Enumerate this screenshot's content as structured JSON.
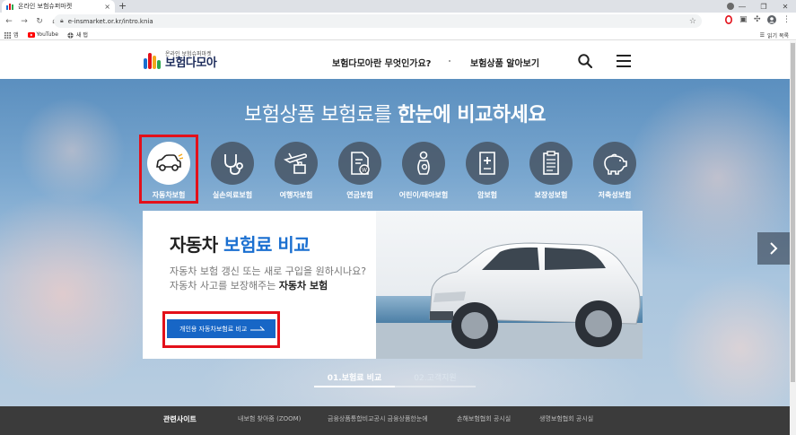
{
  "browser": {
    "tab_title": "온라인 보험슈퍼마켓",
    "close_symbol": "×",
    "new_tab_symbol": "+",
    "url": "e-insmarket.or.kr/intro.knia",
    "bookmarks": [
      {
        "label": "앱",
        "icon": "apps-grid-icon"
      },
      {
        "label": "YouTube",
        "icon": "youtube-icon"
      },
      {
        "label": "새 탭",
        "icon": "globe-icon"
      }
    ],
    "reading_list": "읽기 목록"
  },
  "header": {
    "logo_sub": "온라인 보험슈퍼마켓",
    "logo_main": "보험다모아",
    "nav": [
      "보험다모아란 무엇인가요?",
      "보험상품 알아보기"
    ]
  },
  "hero": {
    "title_normal": "보험상품 보험료를 ",
    "title_bold": "한눈에 비교하세요",
    "categories": [
      {
        "label": "자동차보험",
        "icon": "car-icon",
        "active": true
      },
      {
        "label": "실손의료보험",
        "icon": "stethoscope-icon",
        "active": false
      },
      {
        "label": "여행자보험",
        "icon": "airplane-luggage-icon",
        "active": false
      },
      {
        "label": "연금보험",
        "icon": "pension-document-icon",
        "active": false
      },
      {
        "label": "어린이/태아보험",
        "icon": "baby-icon",
        "active": false
      },
      {
        "label": "암보험",
        "icon": "medical-clipboard-icon",
        "active": false
      },
      {
        "label": "보장성보험",
        "icon": "checklist-icon",
        "active": false
      },
      {
        "label": "저축성보험",
        "icon": "piggy-bank-icon",
        "active": false
      }
    ]
  },
  "card": {
    "title_main": "자동차 ",
    "title_blue": "보험료 비교",
    "desc_line1": "자동차 보험 갱신 또는 새로 구입을 원하시나요?",
    "desc_line2_normal": "자동차 사고를 보장해주는 ",
    "desc_line2_bold": "자동차 보험",
    "button_label": "개인용 자동차보험료 비교"
  },
  "steps": [
    "01.보험료 비교",
    "02.고객지원"
  ],
  "footer": {
    "links": [
      "관련사이트",
      "내보험 찾아줌 (ZOOM)",
      "금융상품통합비교공시 금융상품한눈에",
      "손해보험협회 공시실",
      "생명보험협회 공시실"
    ]
  },
  "colors": {
    "accent_blue": "#1766c6",
    "highlight_red": "#e3101a",
    "footer_bg": "#3b3b3b"
  }
}
